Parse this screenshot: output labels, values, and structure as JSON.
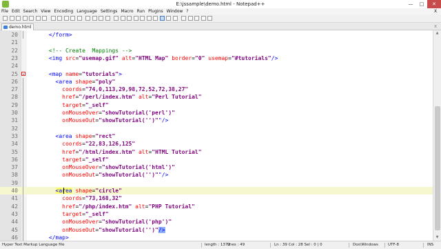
{
  "window": {
    "title": "E:\\jssample\\demo.html - Notepad++"
  },
  "menu": [
    "File",
    "Edit",
    "Search",
    "View",
    "Encoding",
    "Language",
    "Settings",
    "Macro",
    "Run",
    "Plugins",
    "Window",
    "?"
  ],
  "menu_close": "X",
  "tabs": [
    {
      "label": "demo.html",
      "active": true
    }
  ],
  "tab_close": "x",
  "editor": {
    "lines": [
      {
        "n": "20",
        "segs": [
          [
            "t",
            "      "
          ],
          [
            "tag",
            "</form>"
          ]
        ]
      },
      {
        "n": "21",
        "segs": []
      },
      {
        "n": "22",
        "segs": [
          [
            "t",
            "      "
          ],
          [
            "com",
            "<!-- Create  Mappings -->"
          ]
        ]
      },
      {
        "n": "23",
        "segs": [
          [
            "t",
            "      "
          ],
          [
            "tag",
            "<img "
          ],
          [
            "attr",
            "src"
          ],
          [
            "t",
            "="
          ],
          [
            "str",
            "\"usemap.gif\""
          ],
          [
            "t",
            " "
          ],
          [
            "attr",
            "alt"
          ],
          [
            "t",
            "="
          ],
          [
            "str",
            "\"HTML Map\""
          ],
          [
            "t",
            " "
          ],
          [
            "attr",
            "border"
          ],
          [
            "t",
            "="
          ],
          [
            "str",
            "\"0\""
          ],
          [
            "t",
            " "
          ],
          [
            "attr",
            "usemap"
          ],
          [
            "t",
            "="
          ],
          [
            "str",
            "\"#tutorials\""
          ],
          [
            "tag",
            "/>"
          ]
        ]
      },
      {
        "n": "24",
        "segs": []
      },
      {
        "n": "25",
        "segs": [
          [
            "t",
            "      "
          ],
          [
            "tag",
            "<map "
          ],
          [
            "attr",
            "name"
          ],
          [
            "t",
            "="
          ],
          [
            "str",
            "\"tutorials\""
          ],
          [
            "tag",
            ">"
          ]
        ]
      },
      {
        "n": "26",
        "segs": [
          [
            "t",
            "        "
          ],
          [
            "tag",
            "<area "
          ],
          [
            "attr",
            "shape"
          ],
          [
            "t",
            "="
          ],
          [
            "str",
            "\"poly\""
          ]
        ]
      },
      {
        "n": "27",
        "segs": [
          [
            "t",
            "          "
          ],
          [
            "attr",
            "coords"
          ],
          [
            "t",
            "="
          ],
          [
            "str",
            "\"74,0,113,29,98,72,52,72,38,27\""
          ]
        ]
      },
      {
        "n": "28",
        "segs": [
          [
            "t",
            "          "
          ],
          [
            "attr",
            "href"
          ],
          [
            "t",
            "="
          ],
          [
            "str",
            "\"/perl/index.htm\""
          ],
          [
            "t",
            " "
          ],
          [
            "attr",
            "alt"
          ],
          [
            "t",
            "="
          ],
          [
            "str",
            "\"Perl Tutorial\""
          ]
        ]
      },
      {
        "n": "29",
        "segs": [
          [
            "t",
            "          "
          ],
          [
            "attr",
            "target"
          ],
          [
            "t",
            "="
          ],
          [
            "str",
            "\"_self\""
          ]
        ]
      },
      {
        "n": "30",
        "segs": [
          [
            "t",
            "          "
          ],
          [
            "attr",
            "onMouseOver"
          ],
          [
            "t",
            "="
          ],
          [
            "str",
            "\"showTutorial('perl')\""
          ]
        ]
      },
      {
        "n": "31",
        "segs": [
          [
            "t",
            "          "
          ],
          [
            "attr",
            "onMouseOut"
          ],
          [
            "t",
            "="
          ],
          [
            "str",
            "\"showTutorial('')\""
          ],
          [
            "tag",
            "\"/>"
          ]
        ]
      },
      {
        "n": "32",
        "segs": []
      },
      {
        "n": "33",
        "segs": [
          [
            "t",
            "        "
          ],
          [
            "tag",
            "<area "
          ],
          [
            "attr",
            "shape"
          ],
          [
            "t",
            "="
          ],
          [
            "str",
            "\"rect\""
          ]
        ]
      },
      {
        "n": "34",
        "segs": [
          [
            "t",
            "          "
          ],
          [
            "attr",
            "coords"
          ],
          [
            "t",
            "="
          ],
          [
            "str",
            "\"22,83,126,125\""
          ]
        ]
      },
      {
        "n": "35",
        "segs": [
          [
            "t",
            "          "
          ],
          [
            "attr",
            "href"
          ],
          [
            "t",
            "="
          ],
          [
            "str",
            "\"/html/index.htm\""
          ],
          [
            "t",
            " "
          ],
          [
            "attr",
            "alt"
          ],
          [
            "t",
            "="
          ],
          [
            "str",
            "\"HTML Tutorial\""
          ]
        ]
      },
      {
        "n": "36",
        "segs": [
          [
            "t",
            "          "
          ],
          [
            "attr",
            "target"
          ],
          [
            "t",
            "="
          ],
          [
            "str",
            "\"_self\""
          ]
        ]
      },
      {
        "n": "37",
        "segs": [
          [
            "t",
            "          "
          ],
          [
            "attr",
            "onMouseOver"
          ],
          [
            "t",
            "="
          ],
          [
            "str",
            "\"showTutorial('html')\""
          ]
        ]
      },
      {
        "n": "38",
        "segs": [
          [
            "t",
            "          "
          ],
          [
            "attr",
            "onMouseOut"
          ],
          [
            "t",
            "="
          ],
          [
            "str",
            "\"showTutorial('')\""
          ],
          [
            "tag",
            "\"/>"
          ]
        ]
      },
      {
        "n": "39",
        "segs": []
      },
      {
        "n": "40",
        "current": true,
        "segs": [
          [
            "t",
            "        "
          ],
          [
            "hltag",
            "<area"
          ],
          [
            "t",
            " "
          ],
          [
            "attr",
            "shape"
          ],
          [
            "t",
            "="
          ],
          [
            "str",
            "\"circle\""
          ]
        ]
      },
      {
        "n": "41",
        "segs": [
          [
            "t",
            "          "
          ],
          [
            "attr",
            "coords"
          ],
          [
            "t",
            "="
          ],
          [
            "str",
            "\"73,168,32\""
          ]
        ]
      },
      {
        "n": "42",
        "segs": [
          [
            "t",
            "          "
          ],
          [
            "attr",
            "href"
          ],
          [
            "t",
            "="
          ],
          [
            "str",
            "\"/php/index.htm\""
          ],
          [
            "t",
            " "
          ],
          [
            "attr",
            "alt"
          ],
          [
            "t",
            "="
          ],
          [
            "str",
            "\"PHP Tutorial\""
          ]
        ]
      },
      {
        "n": "43",
        "segs": [
          [
            "t",
            "          "
          ],
          [
            "attr",
            "target"
          ],
          [
            "t",
            "="
          ],
          [
            "str",
            "\"_self\""
          ]
        ]
      },
      {
        "n": "44",
        "segs": [
          [
            "t",
            "          "
          ],
          [
            "attr",
            "onMouseOver"
          ],
          [
            "t",
            "="
          ],
          [
            "str",
            "\"showTutorial('php')\""
          ]
        ]
      },
      {
        "n": "45",
        "segs": [
          [
            "t",
            "          "
          ],
          [
            "attr",
            "onMouseOut"
          ],
          [
            "t",
            "="
          ],
          [
            "str",
            "\"showTutorial('')\""
          ],
          [
            "hlend",
            "/>"
          ]
        ]
      },
      {
        "n": "46",
        "segs": [
          [
            "t",
            "      "
          ],
          [
            "tag",
            "</map>"
          ]
        ]
      }
    ]
  },
  "status": {
    "language": "Hyper Text Markup Language file",
    "length": "length : 1372",
    "lines": "lines : 49",
    "position": "Ln : 39   Col : 28   Sel : 0 | 0",
    "eol": "Dos\\Windows",
    "encoding": "UTF-8",
    "mode": "INS"
  },
  "colors": {
    "tag": "#0000ff",
    "attribute": "#ff0000",
    "string": "#7f007f",
    "comment": "#008000",
    "current_line": "#f6f6cf",
    "tag_highlight": "#ffff70"
  }
}
